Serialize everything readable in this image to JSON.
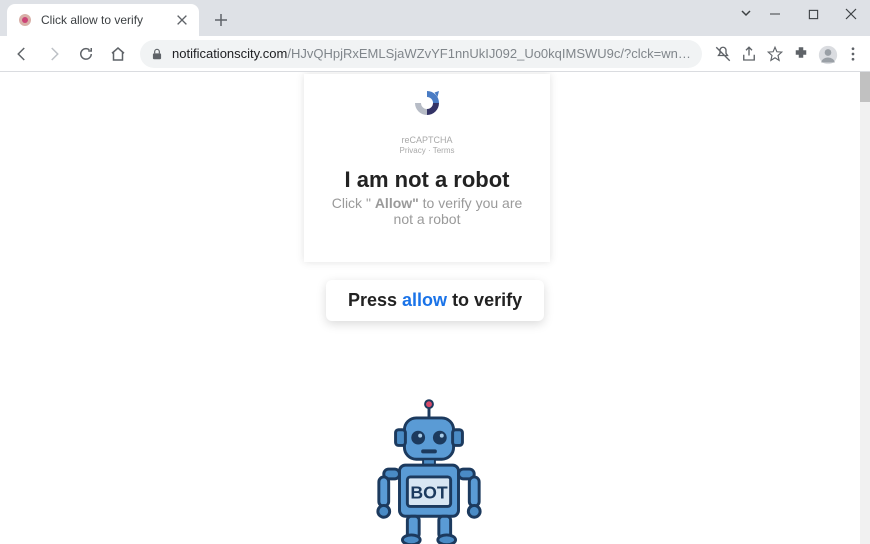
{
  "window": {
    "tab_title": "Click allow to verify"
  },
  "omnibox": {
    "host": "notificationscity.com",
    "path": "/HJvQHpjRxEMLSjaWZvYF1nnUkIJ092_Uo0kqIMSWU9c/?clck=wnp9lpf3929bjbebiitihn..."
  },
  "card": {
    "recaptcha_label": "reCAPTCHA",
    "privacy": "Privacy",
    "terms": "Terms",
    "headline": "I am not a robot",
    "subtext_pre": "Click \" ",
    "subtext_bold": "Allow\"",
    "subtext_post": " to verify you are not a robot"
  },
  "button": {
    "pre": "Press ",
    "hl": "allow",
    "post": " to verify"
  },
  "robot": {
    "label": "BOT"
  }
}
